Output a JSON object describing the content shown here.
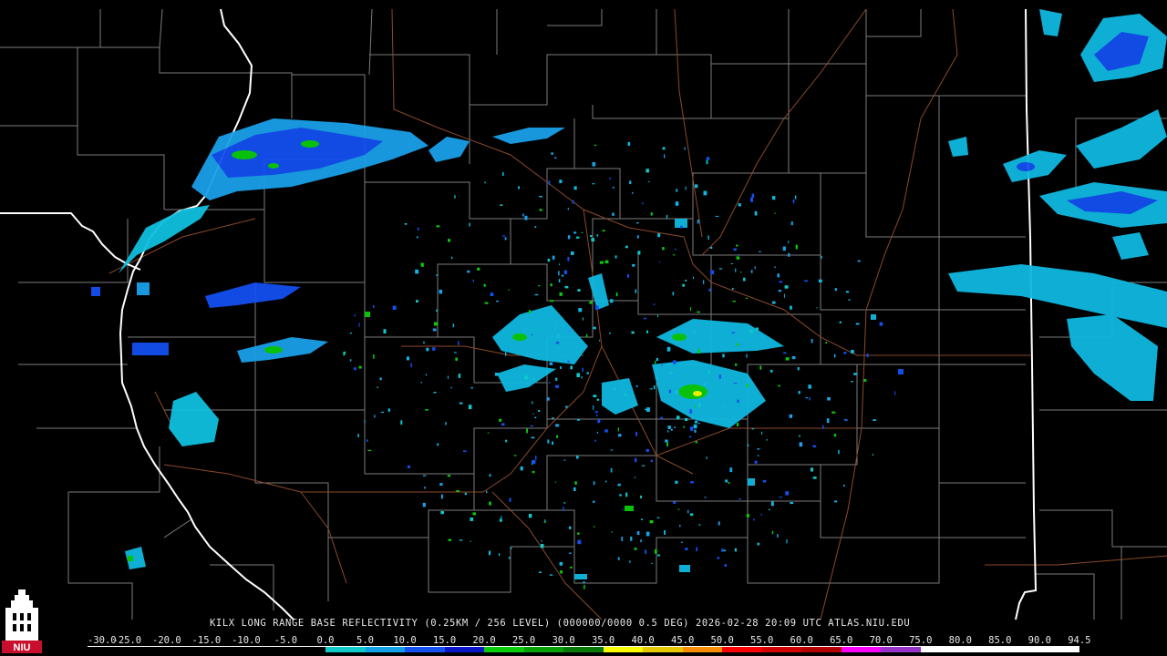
{
  "caption": "KILX LONG RANGE BASE REFLECTIVITY (0.25KM / 256 LEVEL) (000000/0000 0.5 DEG) 2026-02-28 20:09 UTC  ATLAS.NIU.EDU",
  "logo_text": "NIU",
  "scale": {
    "labels": [
      "-30.0",
      "-25.0",
      "-20.0",
      "-15.0",
      "-10.0",
      "-5.0",
      "0.0",
      "5.0",
      "10.0",
      "15.0",
      "20.0",
      "25.0",
      "30.0",
      "35.0",
      "40.0",
      "45.0",
      "50.0",
      "55.0",
      "60.0",
      "65.0",
      "70.0",
      "75.0",
      "80.0",
      "85.0",
      "90.0",
      "94.5"
    ],
    "colors": [
      "#000000",
      "#000000",
      "#000000",
      "#000000",
      "#000000",
      "#000000",
      "#0fc8c8",
      "#0fa0e6",
      "#1450f0",
      "#0a14c8",
      "#0acc0a",
      "#06a006",
      "#067806",
      "#fafa00",
      "#e6c800",
      "#fa8c00",
      "#fa0000",
      "#d20000",
      "#b40000",
      "#fa00fa",
      "#9632c8",
      "#ffffff",
      "#ffffff",
      "#ffffff",
      "#ffffff"
    ]
  },
  "colors": {
    "background": "#000000",
    "county_lines": "#8c8c8c",
    "state_lines": "#ffffff",
    "roads": "#8b4a2a"
  }
}
